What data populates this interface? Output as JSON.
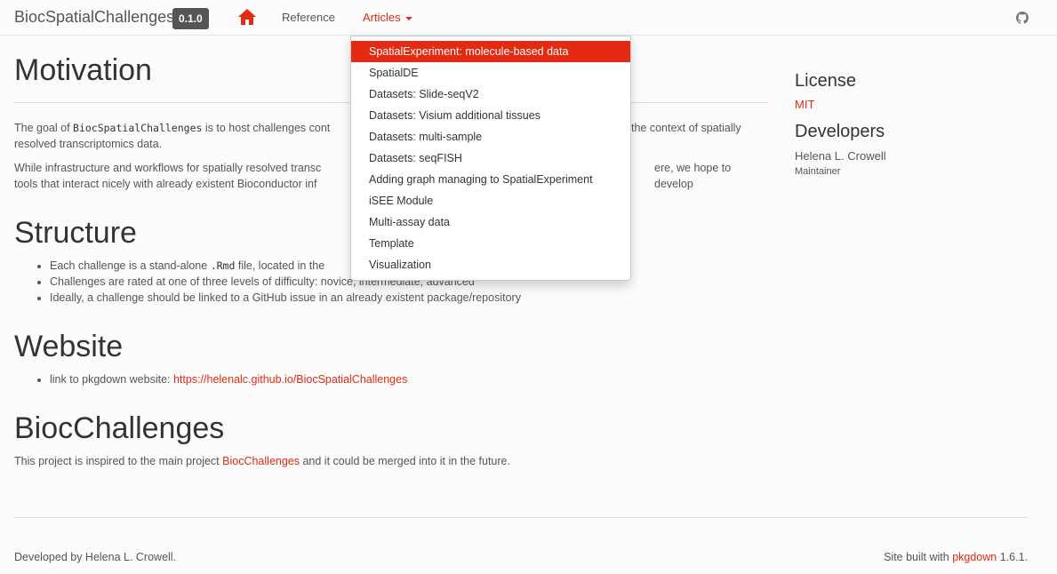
{
  "navbar": {
    "brand": "BiocSpatialChallenges",
    "version": "0.1.0",
    "reference_label": "Reference",
    "articles_label": "Articles"
  },
  "articles_menu": [
    "SpatialExperiment: molecule-based data",
    "SpatialDE",
    "Datasets: Slide-seqV2",
    "Datasets: Visium additional tissues",
    "Datasets: multi-sample",
    "Datasets: seqFISH",
    "Adding graph managing to SpatialExperiment",
    "iSEE Module",
    "Multi-assay data",
    "Template",
    "Visualization"
  ],
  "main": {
    "motivation": {
      "heading": "Motivation",
      "p1_before": "The goal of ",
      "p1_code": "BiocSpatialChallenges",
      "p1_after": " is to host challenges cont",
      "p1_end": "the context of spatially",
      "p1_line2": "resolved transcriptomics data.",
      "p2_line1": "While infrastructure and workflows for spatially resolved transc",
      "p2_line1_end": "ere, we hope to develop",
      "p2_line2": "tools that interact nicely with already existent Bioconductor inf"
    },
    "structure": {
      "heading": "Structure",
      "item1_before": "Each challenge is a stand-alone ",
      "item1_code": ".Rmd",
      "item1_after": " file, located in the",
      "item2": "Challenges are rated at one of three levels of difficulty: novice, intermediate, advanced",
      "item3": "Ideally, a challenge should be linked to a GitHub issue in an already existent package/repository"
    },
    "website": {
      "heading": "Website",
      "item_before": "link to pkgdown website: ",
      "link": "https://helenalc.github.io/BiocSpatialChallenges"
    },
    "biocchallenges": {
      "heading": "BiocChallenges",
      "before": "This project is inspired to the main project ",
      "link": "BiocChallenges",
      "after": " and it could be merged into it in the future."
    }
  },
  "sidebar": {
    "license_heading": "License",
    "license": "MIT",
    "developers_heading": "Developers",
    "developer_name": "Helena L. Crowell",
    "developer_role": "Maintainer"
  },
  "footer": {
    "left": "Developed by Helena L. Crowell.",
    "right_before": "Site built with ",
    "right_link": "pkgdown",
    "right_after": " 1.6.1."
  },
  "colors": {
    "accent": "#e32a13",
    "text": "#333333",
    "muted": "#555555"
  },
  "icons": {
    "home": "home-icon",
    "github": "github-icon"
  }
}
